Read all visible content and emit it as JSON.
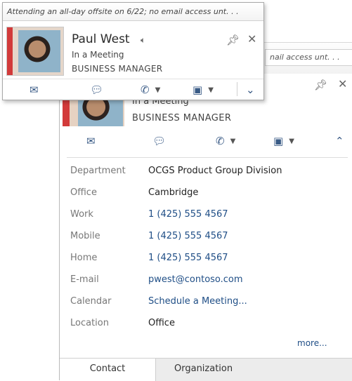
{
  "popup": {
    "note": "Attending an all-day offsite on 6/22; no email access unt. . .",
    "name": "Paul West",
    "status": "In a Meeting",
    "job_title": "BUSINESS MANAGER",
    "icons": {
      "sound": "speaker-icon",
      "pin": "pin-icon",
      "close": "close-icon",
      "email": "email-icon",
      "chat": "chat-icon",
      "phone": "phone-icon",
      "video": "video-icon",
      "expand": "chevron-down-icon"
    }
  },
  "card": {
    "note_tail": "nail access unt. . .",
    "status": "In a Meeting",
    "job_title": "BUSINESS MANAGER",
    "icons": {
      "pin": "pin-icon",
      "close": "close-icon",
      "email": "email-icon",
      "chat": "chat-icon",
      "phone": "phone-icon",
      "video": "video-icon",
      "collapse": "chevron-up-icon"
    },
    "details": [
      {
        "label": "Department",
        "value": "OCGS Product Group Division",
        "link": false
      },
      {
        "label": "Office",
        "value": "Cambridge",
        "link": false
      },
      {
        "label": "Work",
        "value": "1 (425) 555 4567",
        "link": true
      },
      {
        "label": "Mobile",
        "value": "1 (425) 555 4567",
        "link": true
      },
      {
        "label": "Home",
        "value": "1 (425) 555 4567",
        "link": true
      },
      {
        "label": "E-mail",
        "value": "pwest@contoso.com",
        "link": true
      },
      {
        "label": "Calendar",
        "value": "Schedule a Meeting...",
        "link": true
      },
      {
        "label": "Location",
        "value": "Office",
        "link": false
      }
    ],
    "more_label": "more...",
    "tabs": [
      {
        "label": "Contact",
        "active": true
      },
      {
        "label": "Organization",
        "active": false
      }
    ]
  },
  "colors": {
    "presence_busy": "#d23a3a",
    "link": "#1f4e86"
  }
}
